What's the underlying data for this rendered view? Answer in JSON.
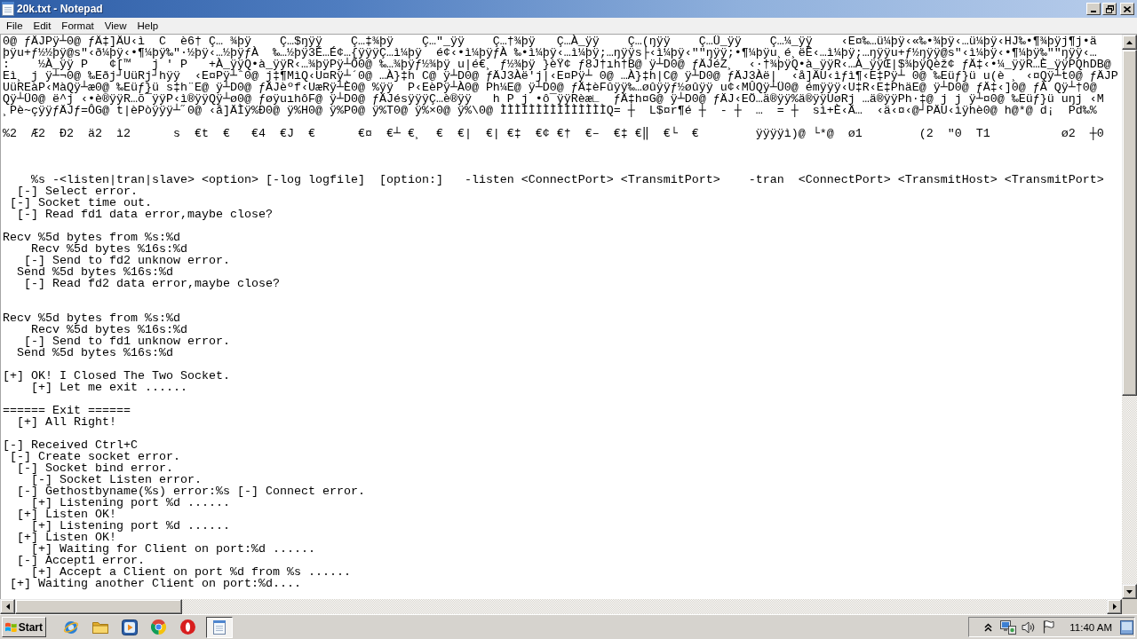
{
  "window": {
    "title": "20k.txt - Notepad"
  },
  "menu_bar": {
    "items": [
      "File",
      "Edit",
      "Format",
      "View",
      "Help"
    ]
  },
  "editor": {
    "text": "0@ ƒÄJPÿ┴0@ ƒÄ‡]ÄU‹ì  C  è6† Ç… ¾þÿ    Ç…$ŋÿÿ    Ç…‡¾þÿ    Ç…\"_ÿÿ    Ç…†¾þÿ   Ç…À_ÿÿ    Ç…(ŋÿÿ    Ç…Ü_ÿÿ    Ç…¼_ÿÿ    ‹E¤‰…ü¼þÿ‹«‰•¾þÿ‹…ü¼þÿ‹HJ‰•¶¾þÿj¶j•ä\nþÿu+ƒ½½þÿ@s\"‹ð¼þÿ‹•¶¼þÿ‰\"·½þÿ‹…½þÿƒÀ  ‰…½þÿ3É…É¢…{ÿÿÿÇ…ì¼þÿ  é¢‹•ì¼þÿƒÀ ‰•ì¼þÿ‹…ì¼þÿ;…ŋÿÿs├‹ì¼þÿ‹\"\"ŋÿÿ;•¶¼þÿu¸é¸ëÊ‹…ì¼þÿ;…ŋÿÿu+ƒ½ŋÿÿ@s\"‹ì¼þÿ‹•¶¼þÿ‰\"\"ŋÿÿ‹…\n:    ½À_ÿÿ P   ¢[™   j ' P   +À_ÿÿQ•à_ÿÿR‹…¾þÿPÿ┴Ô0@ ‰…¾þÿƒ½¾þÿ u|é€¸ ƒ½¾þÿ }èŸ¢ ƒ8J†ıh†B@ ÿ┴D0@ ƒÄJéZ¸  ‹·†¾þÿQ•à_ÿÿR‹…À_ÿÿŒ|$¾þÿQèž¢ ƒÄ‡‹•¼_ÿÿR…È_ÿÿPQhDB@\nEì¸ j ÿ┴¬0@ ‰Eðj┘UüRj┘hÿÿ  ‹E¤Pÿ┴ˆ0@ j‡¶MìQ‹U¤Rÿ┴´0@ …À}‡h C@ ÿ┴D0@ ƒÄJ3Àë'j|‹E¤Pÿ┴ 0@ …À}‡h|C@ ÿ┴D0@ ƒÄJ3Àë|  ‹å]ÄU‹ìƒì¶‹E‡Pÿ┴ 0@ ‰Eüƒ}ü u(è ¸ ‹¤Qÿ┴t0@ ƒÄJP\nUüREàP‹MàQÿ┴æ0@ ‰Eüƒ}ü s‡h¨E@ ÿ┴D0@ ƒÄJèºf‹UæRÿ┴È0@ %ÿÿ  P‹EèPÿ┴À0@ Ph¼E@ ÿ┴D0@ ƒÄ‡èFûÿÿ‰…øûÿÿƒ½øûÿÿ u¢‹MÛQÿ┴Ü0@ émÿÿÿ‹U‡R‹E‡PhäE@ ÿ┴D0@ ƒÄ‡‹]0@ ƒÀ Qÿ┴†0@\nQÿ┴Ü0@ ë^j ‹•è®ÿÿR…õ¯ÿÿP‹ì®ÿÿQÿ┴ø0@ ƒøÿuıhôF@ ÿ┴D0@ ƒÄJésÿÿÿÇ…è®ÿÿ   h P j •ô¯ÿÿRèæ∟  ƒÄ‡h¤G@ ÿ┴D0@ ƒÄJ‹EÖ…ä®ÿÿ%ä®ÿÿUøRj …ä®ÿÿPh·‡@ j j ÿ┴¤0@ ‰Eüƒ}ü uŋj ‹M\n¸Pè~çÿÿƒÄJƒ=ÔG@ t|èPòÿÿÿ┴˝0@ ‹å]ÄÌÿ%Ð0@ ÿ%H0@ ÿ%P0@ ÿ%T0@ ÿ%×0@ ÿ%\\0@ ÌÌÌÌÌÌÌÌÌÌÌÌÌÌÌQ= ┼  L$¤r¶é ┼  - ┼  …  = ┼  sì+È‹Ä…  ‹ä‹¤‹@┘PÄU‹ìÿhè0@ h@*@ d¡  Pd‰%\n\n%2  Æ2  Ð2  ä2  ì2      s  €t  €   €4  €J  €      €¤  €┴ €¸  €  €|  €| €‡  €¢ €†  €–  €‡ €‖  €└  €        ÿÿÿÿì)@ └*@  ø1        (2  \"0  T1          ø2  ┼0\n\n\n\n    %s -<listen|tran|slave> <option> [-log logfile]  [option:]   -listen <ConnectPort> <TransmitPort>    -tran  <ConnectPort> <TransmitHost> <TransmitPort>\n  [-] Select error.\n [-] Socket time out.\n  [-] Read fd1 data error,maybe close?\n\nRecv %5d bytes from %s:%d\n    Recv %5d bytes %16s:%d\n   [-] Send to fd2 unknow error.\n  Send %5d bytes %16s:%d\n   [-] Read fd2 data error,maybe close?\n\n\nRecv %5d bytes from %s:%d\n    Recv %5d bytes %16s:%d\n   [-] Send to fd1 unknow error.\n  Send %5d bytes %16s:%d\n\n[+] OK! I Closed The Two Socket.\n    [+] Let me exit ......\n\n====== Exit ======\n  [+] All Right!\n\n[-] Received Ctrl+C\n [-] Create socket error.\n  [-] Socket bind error.\n    [-] Socket Listen error.\n  [-] Gethostbyname(%s) error:%s [-] Connect error.\n    [+] Listening port %d ......\n  [+] Listen OK!\n    [+] Listening port %d ......\n  [+] Listen OK!\n    [+] Waiting for Client on port:%d ......\n  [-] Accept1 error.\n    [+] Accept a Client on port %d from %s ......\n [+] Waiting another Client on port:%d...."
  },
  "taskbar": {
    "start": "Start",
    "quick_launch": [
      {
        "kind": "globe"
      },
      {
        "kind": "folder"
      },
      {
        "kind": "media"
      },
      {
        "kind": "wheel"
      },
      {
        "kind": "ring"
      }
    ],
    "tasks": [
      {
        "kind": "notepad",
        "selected": true
      }
    ],
    "clock": "11:40 AM"
  }
}
